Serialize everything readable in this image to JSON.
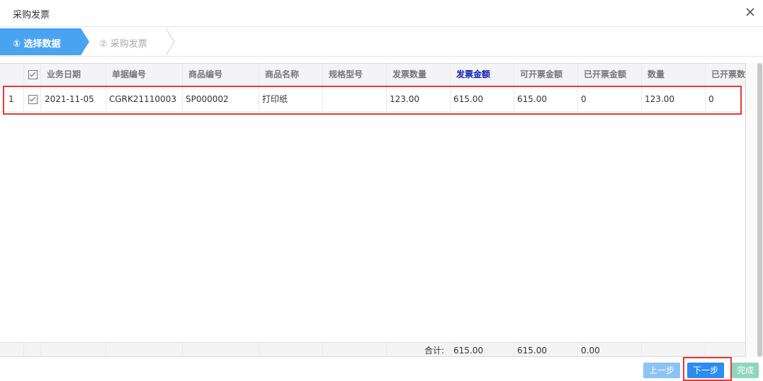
{
  "dialog": {
    "title": "采购发票"
  },
  "steps": [
    {
      "label": "① 选择数据",
      "active": true
    },
    {
      "label": "② 采购发票",
      "active": false
    }
  ],
  "grid": {
    "headers": [
      "",
      "业务日期",
      "单据编号",
      "商品编号",
      "商品名称",
      "规格型号",
      "发票数量",
      "发票金额",
      "可开票金额",
      "已开票金额",
      "数量",
      "已开票数"
    ],
    "rows": [
      {
        "index": "1",
        "checked": true,
        "date": "2021-11-05",
        "doc_no": "CGRK21110003",
        "item_code": "SP000002",
        "item_name": "打印纸",
        "spec": "",
        "inv_qty": "123.00",
        "inv_amount": "615.00",
        "available_amount": "615.00",
        "invoiced_amount": "0",
        "qty": "123.00",
        "invoiced_qty": "0"
      }
    ],
    "footer": {
      "label": "合计:",
      "inv_amount": "615.00",
      "available_amount": "615.00",
      "invoiced_amount": "0.00"
    }
  },
  "buttons": {
    "prev": "上一步",
    "next": "下一步",
    "finish": "完成"
  },
  "colors": {
    "accent": "#4aa3f0",
    "next": "#2d8cf0",
    "prev_disabled": "#8cc3f5",
    "finish_disabled": "#8fd6c0",
    "highlight": "#e53935"
  }
}
